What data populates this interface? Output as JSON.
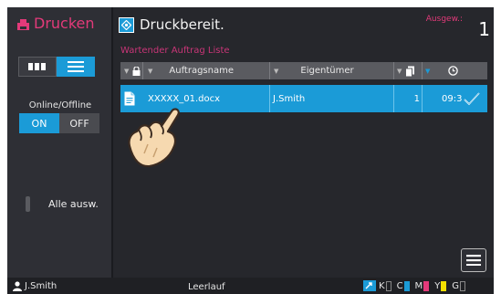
{
  "sidebar": {
    "title": "Drucken",
    "online_offline_label": "Online/Offline",
    "on_label": "ON",
    "off_label": "OFF",
    "select_all_label": "Alle ausw.",
    "view_toggle": {
      "grid_icon": "grid-view-icon",
      "list_icon": "list-view-icon",
      "active": "list"
    }
  },
  "main": {
    "status_title": "Druckbereit.",
    "selected_label": "Ausgew.:",
    "selected_count": "1",
    "queue_label": "Wartender Auftrag Liste",
    "columns": {
      "name": "Auftragsname",
      "owner": "Eigentümer"
    },
    "job": {
      "name": "XXXXX_01.docx",
      "owner": "J.Smith",
      "copies": "1",
      "time": "09:3"
    }
  },
  "status_bar": {
    "user": "J.Smith",
    "state": "Leerlauf",
    "toner": [
      {
        "label": "K",
        "color": "#222222"
      },
      {
        "label": "C",
        "color": "#1b9bd7"
      },
      {
        "label": "M",
        "color": "#e33a7a"
      },
      {
        "label": "Y",
        "color": "#f5e000"
      },
      {
        "label": "G",
        "color": "#777777"
      }
    ]
  },
  "colors": {
    "accent": "#1b9bd7",
    "brand": "#e33a7a",
    "background": "#26272c"
  }
}
